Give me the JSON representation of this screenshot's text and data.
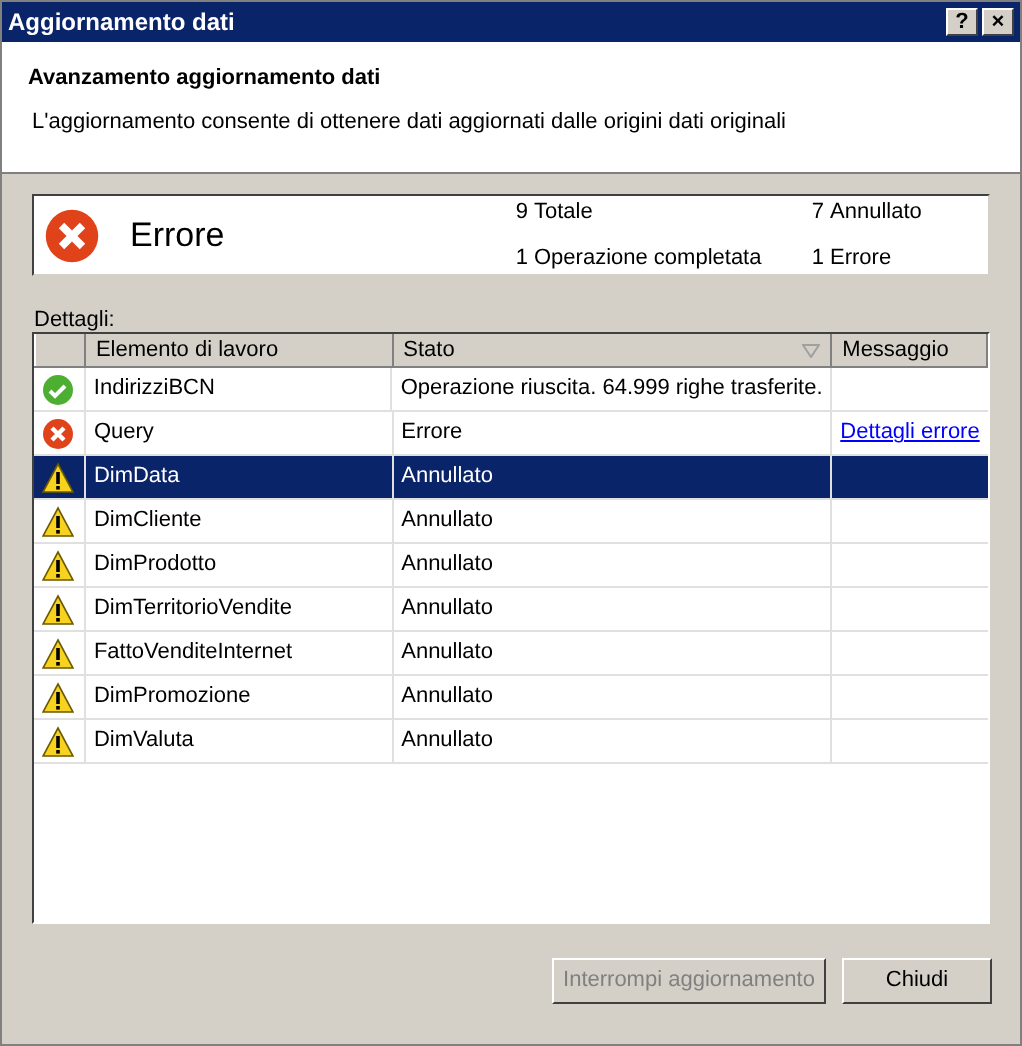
{
  "window": {
    "title": "Aggiornamento dati",
    "title_buttons": [
      "?",
      "×"
    ]
  },
  "header": {
    "title": "Avanzamento aggiornamento dati",
    "description": "L'aggiornamento consente di ottenere dati aggiornati dalle origini dati originali"
  },
  "summary": {
    "kind": "error",
    "status": "Errore",
    "counts": [
      {
        "value": "9",
        "label": "Totale"
      },
      {
        "value": "7",
        "label": "Annullato"
      },
      {
        "value": "1",
        "label": "Operazione completata"
      },
      {
        "value": "1",
        "label": "Errore"
      }
    ]
  },
  "details_label": "Dettagli:",
  "table": {
    "columns": [
      {
        "label": "Elemento di lavoro",
        "sorted": false
      },
      {
        "label": "Stato",
        "sorted": true
      },
      {
        "label": "Messaggio",
        "sorted": false
      }
    ],
    "rows": [
      {
        "kind": "success",
        "item": "IndirizziBCN",
        "status": "Operazione riuscita. 64.999 righe trasferite.",
        "selected": false
      },
      {
        "kind": "error",
        "item": "Query",
        "status": "Errore",
        "message_link": "Dettagli errore",
        "selected": false
      },
      {
        "kind": "warning",
        "item": "DimData",
        "status": "Annullato",
        "selected": true
      },
      {
        "kind": "warning",
        "item": "DimCliente",
        "status": "Annullato",
        "selected": false
      },
      {
        "kind": "warning",
        "item": "DimProdotto",
        "status": "Annullato",
        "selected": false
      },
      {
        "kind": "warning",
        "item": "DimTerritorioVendite",
        "status": "Annullato",
        "selected": false
      },
      {
        "kind": "warning",
        "item": "FattoVenditeInternet",
        "status": "Annullato",
        "selected": false
      },
      {
        "kind": "warning",
        "item": "DimPromozione",
        "status": "Annullato",
        "selected": false
      },
      {
        "kind": "warning",
        "item": "DimValuta",
        "status": "Annullato",
        "selected": false
      }
    ]
  },
  "buttons": [
    {
      "label": "Interrompi aggiornamento",
      "disabled": true
    },
    {
      "label": "Chiudi",
      "disabled": false
    }
  ]
}
